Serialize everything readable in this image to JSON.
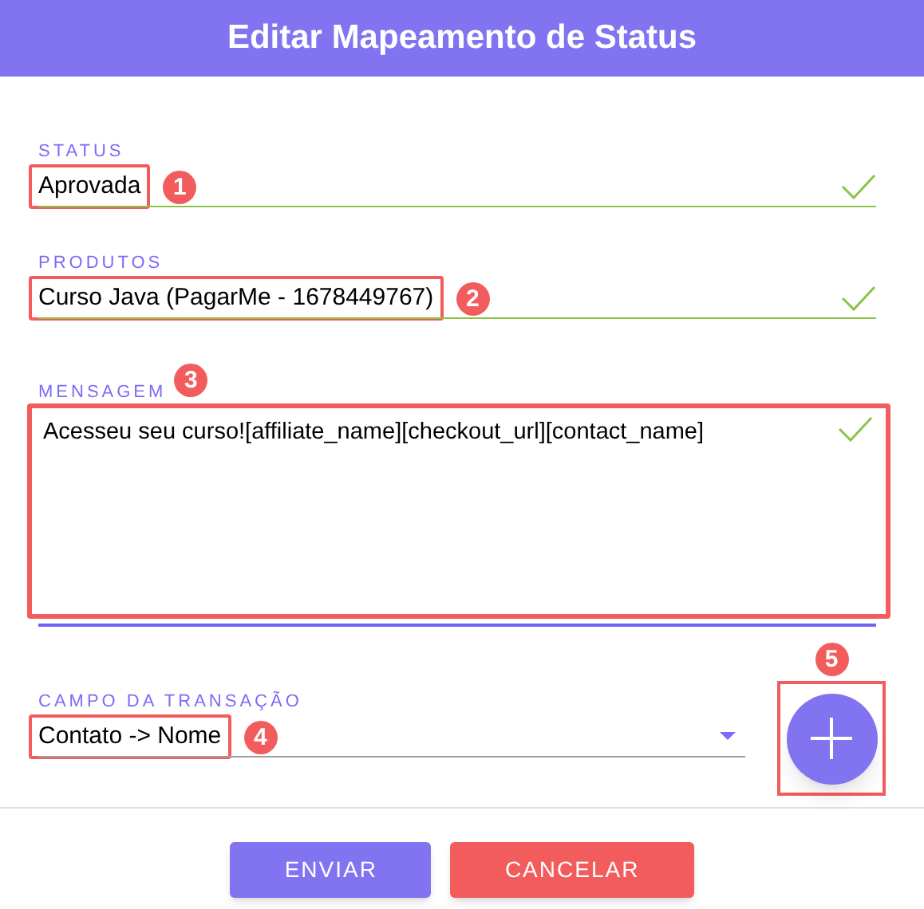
{
  "dialog": {
    "title": "Editar Mapeamento de Status"
  },
  "fields": [
    {
      "kind": "text",
      "label": "STATUS",
      "value": "Aprovada",
      "valid": true,
      "callout": "1"
    },
    {
      "kind": "text",
      "label": "PRODUTOS",
      "value": "Curso Java (PagarMe - 1678449767)",
      "valid": true,
      "callout": "2"
    },
    {
      "kind": "textarea",
      "label": "MENSAGEM",
      "value": "Acesseu seu curso![affiliate_name][checkout_url][contact_name]",
      "valid": true,
      "focused": true,
      "callout": "3"
    },
    {
      "kind": "select",
      "label": "CAMPO DA TRANSAÇÃO",
      "value": "Contato -> Nome",
      "valid": false,
      "callout": "4"
    }
  ],
  "add_button": {
    "callout": "5"
  },
  "buttons": [
    {
      "kind": "primary",
      "label": "ENVIAR"
    },
    {
      "kind": "danger",
      "label": "CANCELAR"
    }
  ]
}
